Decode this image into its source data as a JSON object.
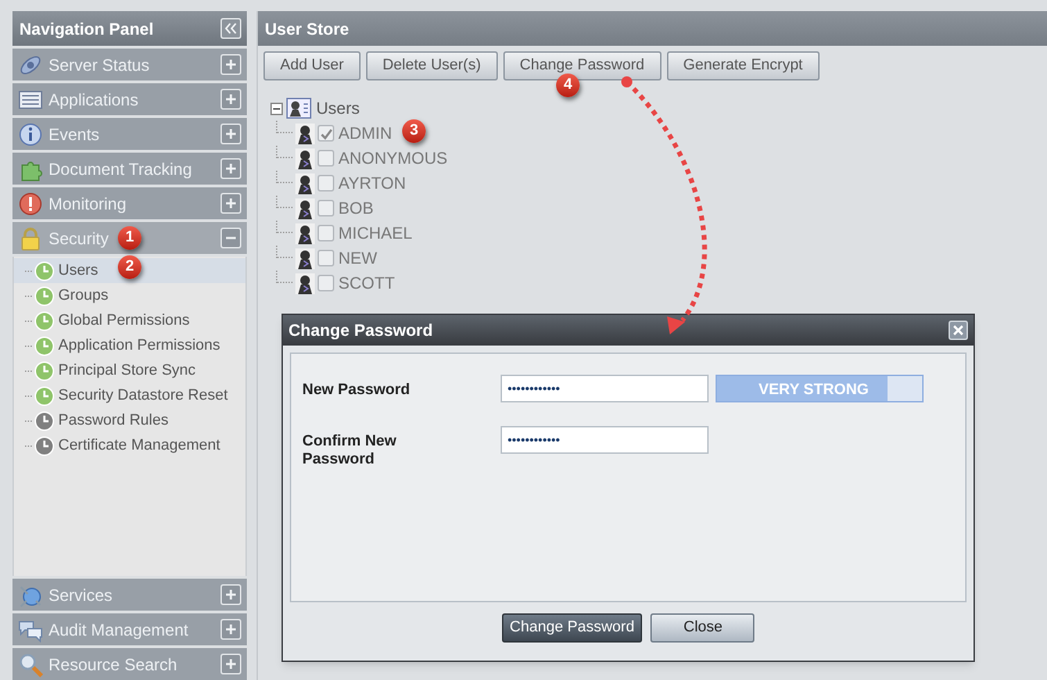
{
  "navigation_panel": {
    "title": "Navigation Panel",
    "sections": [
      {
        "label": "Server Status",
        "expanded": false
      },
      {
        "label": "Applications",
        "expanded": false
      },
      {
        "label": "Events",
        "expanded": false
      },
      {
        "label": "Document Tracking",
        "expanded": false
      },
      {
        "label": "Monitoring",
        "expanded": false
      },
      {
        "label": "Security",
        "expanded": true,
        "items": [
          {
            "label": "Users",
            "selected": true,
            "color": "#8fc46a"
          },
          {
            "label": "Groups",
            "selected": false,
            "color": "#8fc46a"
          },
          {
            "label": "Global Permissions",
            "selected": false,
            "color": "#8fc46a"
          },
          {
            "label": "Application Permissions",
            "selected": false,
            "color": "#8fc46a"
          },
          {
            "label": "Principal Store Sync",
            "selected": false,
            "color": "#8fc46a"
          },
          {
            "label": "Security Datastore Reset",
            "selected": false,
            "color": "#8fc46a"
          },
          {
            "label": "Password Rules",
            "selected": false,
            "color": "#808080"
          },
          {
            "label": "Certificate Management",
            "selected": false,
            "color": "#808080"
          }
        ]
      },
      {
        "label": "Services",
        "expanded": false
      },
      {
        "label": "Audit Management",
        "expanded": false
      },
      {
        "label": "Resource Search",
        "expanded": false
      }
    ]
  },
  "user_store": {
    "title": "User Store",
    "buttons": [
      "Add User",
      "Delete User(s)",
      "Change Password",
      "Generate Encrypt"
    ],
    "tree": {
      "label": "Users",
      "expanded": true,
      "children": [
        {
          "label": "ADMIN",
          "checked": true
        },
        {
          "label": "ANONYMOUS",
          "checked": false
        },
        {
          "label": "AYRTON",
          "checked": false
        },
        {
          "label": "BOB",
          "checked": false
        },
        {
          "label": "MICHAEL",
          "checked": false
        },
        {
          "label": "NEW",
          "checked": false
        },
        {
          "label": "SCOTT",
          "checked": false
        }
      ]
    }
  },
  "dialog": {
    "title": "Change Password",
    "fields": [
      {
        "label": "New Password",
        "value": "••••••••••••",
        "strength": {
          "text": "VERY STRONG",
          "level": 0.83
        }
      },
      {
        "label": "Confirm New Password",
        "value": "••••••••••••"
      }
    ],
    "buttons": [
      {
        "label": "Change Password",
        "primary": true
      },
      {
        "label": "Close",
        "primary": false
      }
    ]
  },
  "annotations": [
    "1",
    "2",
    "3",
    "4"
  ]
}
